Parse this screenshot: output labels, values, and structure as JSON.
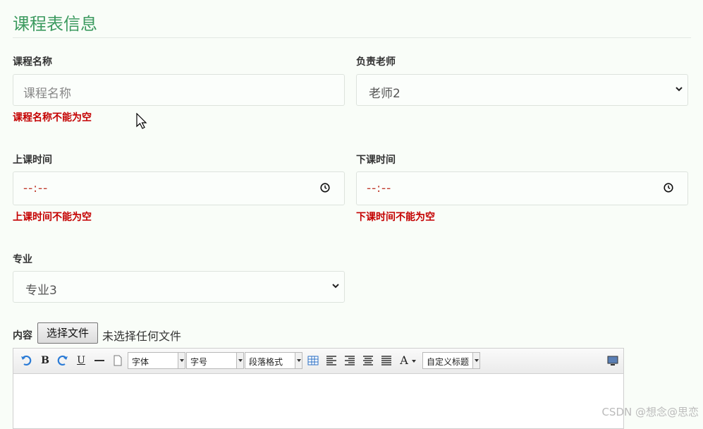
{
  "page": {
    "title": "课程表信息"
  },
  "course_name": {
    "label": "课程名称",
    "placeholder": "课程名称",
    "error": "课程名称不能为空"
  },
  "teacher": {
    "label": "负责老师",
    "selected": "老师2"
  },
  "start_time": {
    "label": "上课时间",
    "value": "--:--",
    "error": "上课时间不能为空"
  },
  "end_time": {
    "label": "下课时间",
    "value": "--:--",
    "error": "下课时间不能为空"
  },
  "major": {
    "label": "专业",
    "selected": "专业3"
  },
  "content": {
    "label": "内容",
    "file_button": "选择文件",
    "file_status": "未选择任何文件"
  },
  "editor": {
    "font_family": "字体",
    "font_size": "字号",
    "paragraph": "段落格式",
    "custom_title": "自定义标题",
    "bold": "B",
    "underline": "U",
    "font_color": "A"
  },
  "watermark": "CSDN @想念@思恋",
  "colors": {
    "title": "#3c9a5f",
    "error": "#c40000",
    "time_placeholder": "#c0392b"
  }
}
